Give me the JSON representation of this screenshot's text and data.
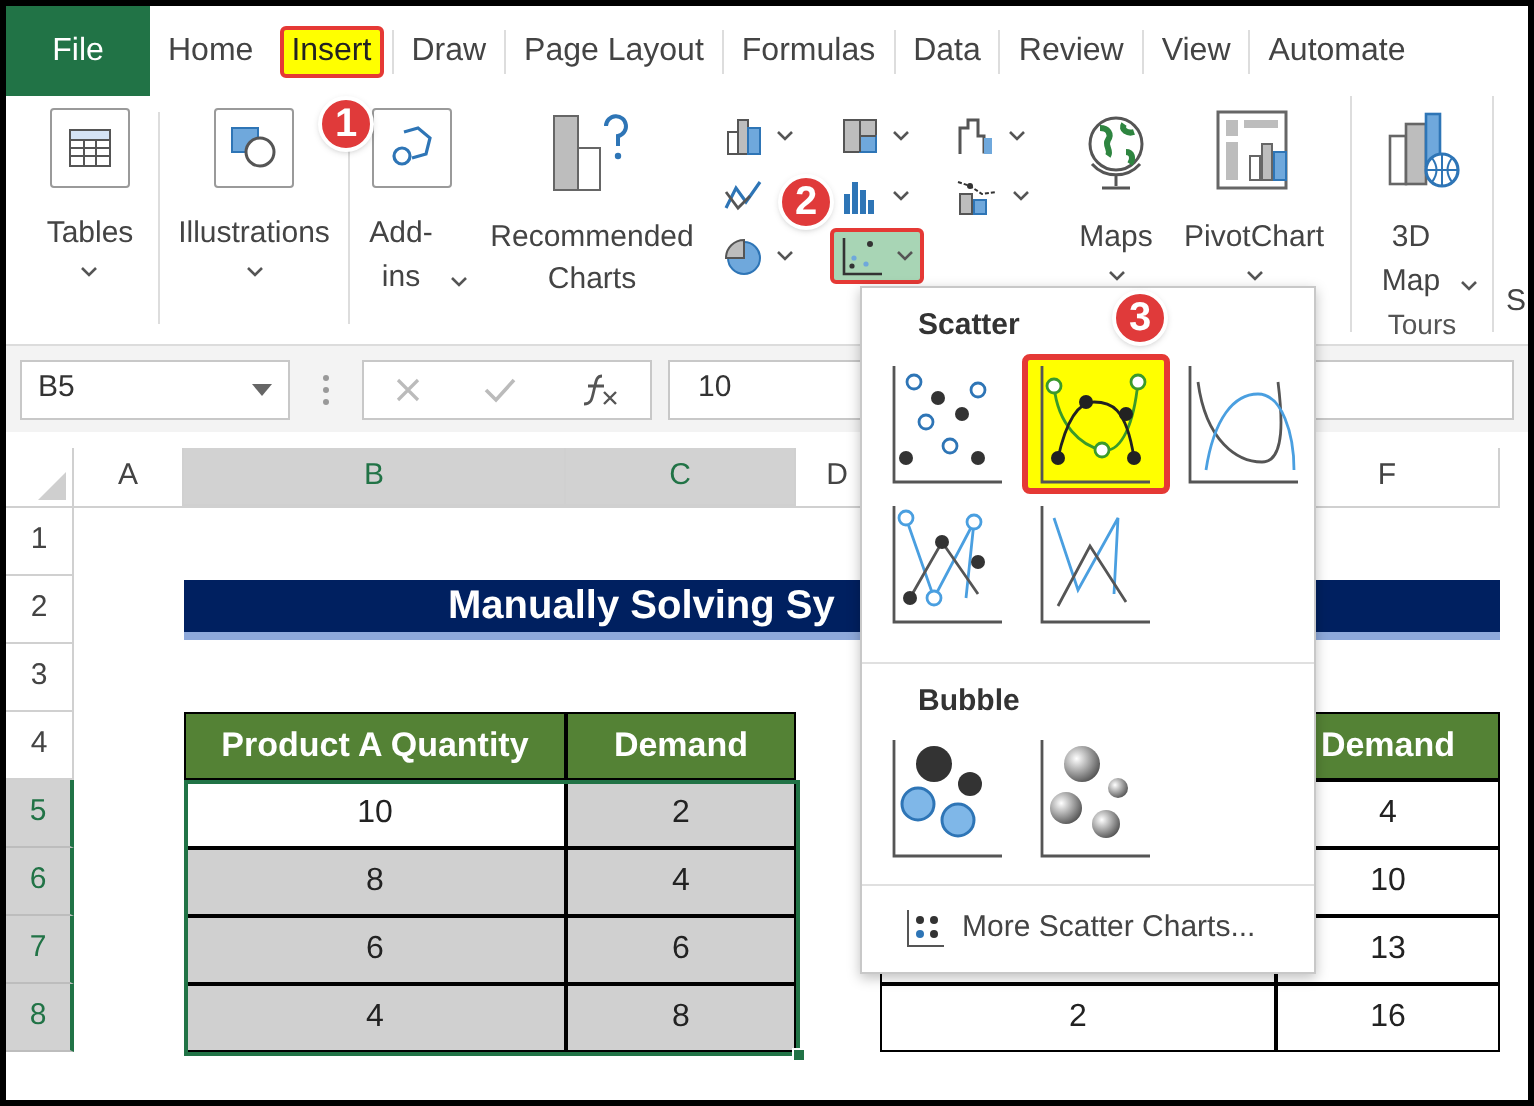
{
  "tabs": [
    {
      "label": "File",
      "kind": "file",
      "selected": false
    },
    {
      "label": "Home",
      "kind": "tab",
      "selected": false
    },
    {
      "label": "Insert",
      "kind": "tab",
      "selected": true
    },
    {
      "label": "Draw",
      "kind": "tab",
      "selected": false
    },
    {
      "label": "Page Layout",
      "kind": "tab",
      "selected": false
    },
    {
      "label": "Formulas",
      "kind": "tab",
      "selected": false
    },
    {
      "label": "Data",
      "kind": "tab",
      "selected": false
    },
    {
      "label": "Review",
      "kind": "tab",
      "selected": false
    },
    {
      "label": "View",
      "kind": "tab",
      "selected": false
    },
    {
      "label": "Automate",
      "kind": "tab",
      "selected": false
    }
  ],
  "ribbon": {
    "groups_left": [
      {
        "label": "Tables",
        "kind": "tables",
        "dropdown": true
      },
      {
        "label": "Illustrations",
        "kind": "illustrations",
        "dropdown": true
      },
      {
        "label": "Add-ins",
        "kind": "addins",
        "dropdown": true
      },
      {
        "label": "Recommended Charts",
        "kind": "recommended",
        "dropdown": false
      }
    ],
    "chart_buttons": [
      {
        "kind": "column",
        "selected": false,
        "dropdown": true
      },
      {
        "kind": "hierarchy",
        "selected": false,
        "dropdown": true
      },
      {
        "kind": "waterfall",
        "selected": false,
        "dropdown": true
      },
      {
        "kind": "line",
        "selected": false,
        "dropdown": false
      },
      {
        "kind": "histogram",
        "selected": false,
        "dropdown": true
      },
      {
        "kind": "combo",
        "selected": false,
        "dropdown": true
      },
      {
        "kind": "pie",
        "selected": false,
        "dropdown": true
      },
      {
        "kind": "scatter",
        "selected": true,
        "dropdown": true
      }
    ],
    "groups_right": [
      {
        "label": "Maps",
        "kind": "maps",
        "dropdown": true
      },
      {
        "label": "PivotChart",
        "kind": "pivot",
        "dropdown": true
      },
      {
        "label": "3D Map",
        "kind": "map3d",
        "dropdown": true,
        "group_label": "Tours"
      }
    ],
    "cut_label": "S"
  },
  "formula_bar": {
    "name_box": "B5",
    "value": "10"
  },
  "sheet": {
    "columns": [
      {
        "label": "A",
        "selected": false
      },
      {
        "label": "B",
        "selected": true
      },
      {
        "label": "C",
        "selected": true
      },
      {
        "label": "D",
        "selected": false
      },
      {
        "label": "F",
        "selected": false
      }
    ],
    "rows": [
      {
        "label": "1",
        "selected": false
      },
      {
        "label": "2",
        "selected": false
      },
      {
        "label": "3",
        "selected": false
      },
      {
        "label": "4",
        "selected": false
      },
      {
        "label": "5",
        "selected": true
      },
      {
        "label": "6",
        "selected": true
      },
      {
        "label": "7",
        "selected": true
      },
      {
        "label": "8",
        "selected": true
      }
    ],
    "title": "Manually Solving Sy",
    "left_table": {
      "headers": [
        "Product A Quantity",
        "Demand"
      ],
      "rows": [
        {
          "selected": true,
          "cells": [
            {
              "text": "10",
              "active": true
            },
            {
              "text": "2",
              "active": false
            }
          ]
        },
        {
          "selected": true,
          "cells": [
            {
              "text": "8",
              "active": false
            },
            {
              "text": "4",
              "active": false
            }
          ]
        },
        {
          "selected": true,
          "cells": [
            {
              "text": "6",
              "active": false
            },
            {
              "text": "6",
              "active": false
            }
          ]
        },
        {
          "selected": true,
          "cells": [
            {
              "text": "4",
              "active": false
            },
            {
              "text": "8",
              "active": false
            }
          ]
        }
      ]
    },
    "right_table": {
      "header": "Demand",
      "rows": [
        {
          "column_f": "4"
        },
        {
          "column_f": "10"
        },
        {
          "column_f": "13"
        },
        {
          "column_e": "2",
          "column_f": "16"
        }
      ]
    }
  },
  "scatter_menu": {
    "sections": [
      {
        "title": "Scatter",
        "items": [
          {
            "kind": "markers",
            "selected": false
          },
          {
            "kind": "smooth-markers",
            "selected": true
          },
          {
            "kind": "smooth",
            "selected": false
          },
          {
            "kind": "straight-markers",
            "selected": false
          },
          {
            "kind": "straight",
            "selected": false
          }
        ]
      },
      {
        "title": "Bubble",
        "items": [
          {
            "kind": "bubble",
            "selected": false
          },
          {
            "kind": "bubble-3d",
            "selected": false
          }
        ]
      }
    ],
    "more": "More Scatter Charts..."
  },
  "annotations": [
    {
      "label": "1"
    },
    {
      "label": "2"
    },
    {
      "label": "3"
    }
  ]
}
